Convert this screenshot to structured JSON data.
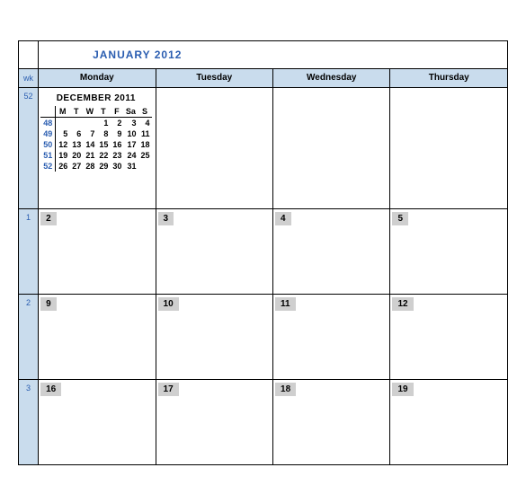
{
  "title": "JANUARY 2012",
  "wk_header": "wk",
  "day_headers": [
    "Monday",
    "Tuesday",
    "Wednesday",
    "Thursday"
  ],
  "rows": [
    {
      "wk": "52",
      "days": [
        "",
        "",
        "",
        ""
      ]
    },
    {
      "wk": "1",
      "days": [
        "2",
        "3",
        "4",
        "5"
      ]
    },
    {
      "wk": "2",
      "days": [
        "9",
        "10",
        "11",
        "12"
      ]
    },
    {
      "wk": "3",
      "days": [
        "16",
        "17",
        "18",
        "19"
      ]
    }
  ],
  "mini": {
    "title": "DECEMBER 2011",
    "dow": [
      "M",
      "T",
      "W",
      "T",
      "F",
      "Sa",
      "S"
    ],
    "rows": [
      {
        "wk": "48",
        "d": [
          "",
          "",
          "",
          "1",
          "2",
          "3",
          "4"
        ]
      },
      {
        "wk": "49",
        "d": [
          "5",
          "6",
          "7",
          "8",
          "9",
          "10",
          "11"
        ]
      },
      {
        "wk": "50",
        "d": [
          "12",
          "13",
          "14",
          "15",
          "16",
          "17",
          "18"
        ]
      },
      {
        "wk": "51",
        "d": [
          "19",
          "20",
          "21",
          "22",
          "23",
          "24",
          "25"
        ]
      },
      {
        "wk": "52",
        "d": [
          "26",
          "27",
          "28",
          "29",
          "30",
          "31",
          ""
        ]
      }
    ]
  }
}
